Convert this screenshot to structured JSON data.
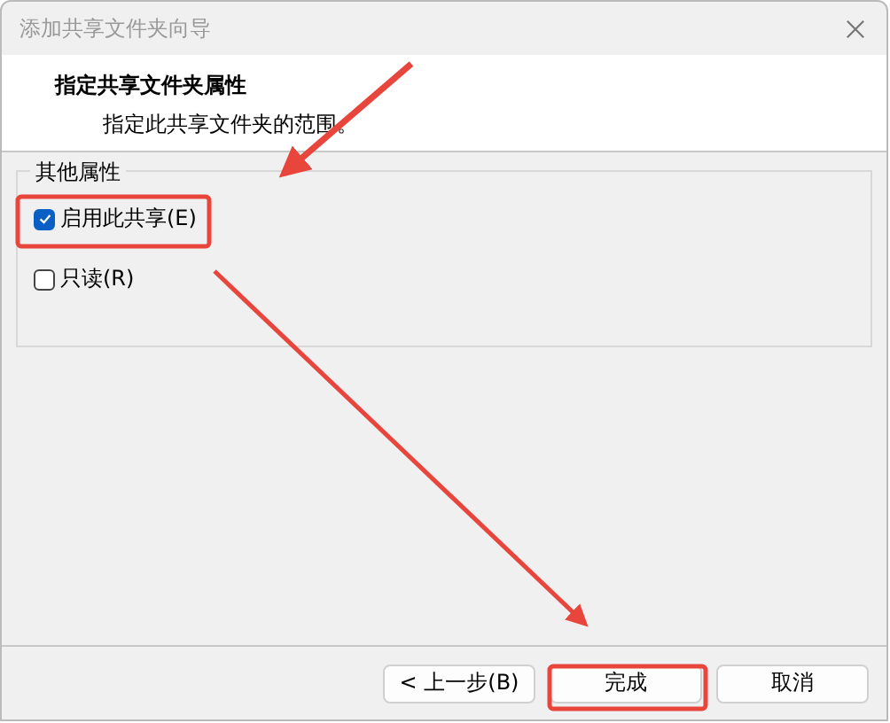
{
  "window": {
    "title": "添加共享文件夹向导"
  },
  "header": {
    "title": "指定共享文件夹属性",
    "subtitle": "指定此共享文件夹的范围。"
  },
  "group": {
    "title": "其他属性",
    "options": [
      {
        "label": "启用此共享(E)",
        "checked": true
      },
      {
        "label": "只读(R)",
        "checked": false
      }
    ]
  },
  "buttons": [
    "< 上一步(B)",
    "完成",
    "取消"
  ]
}
